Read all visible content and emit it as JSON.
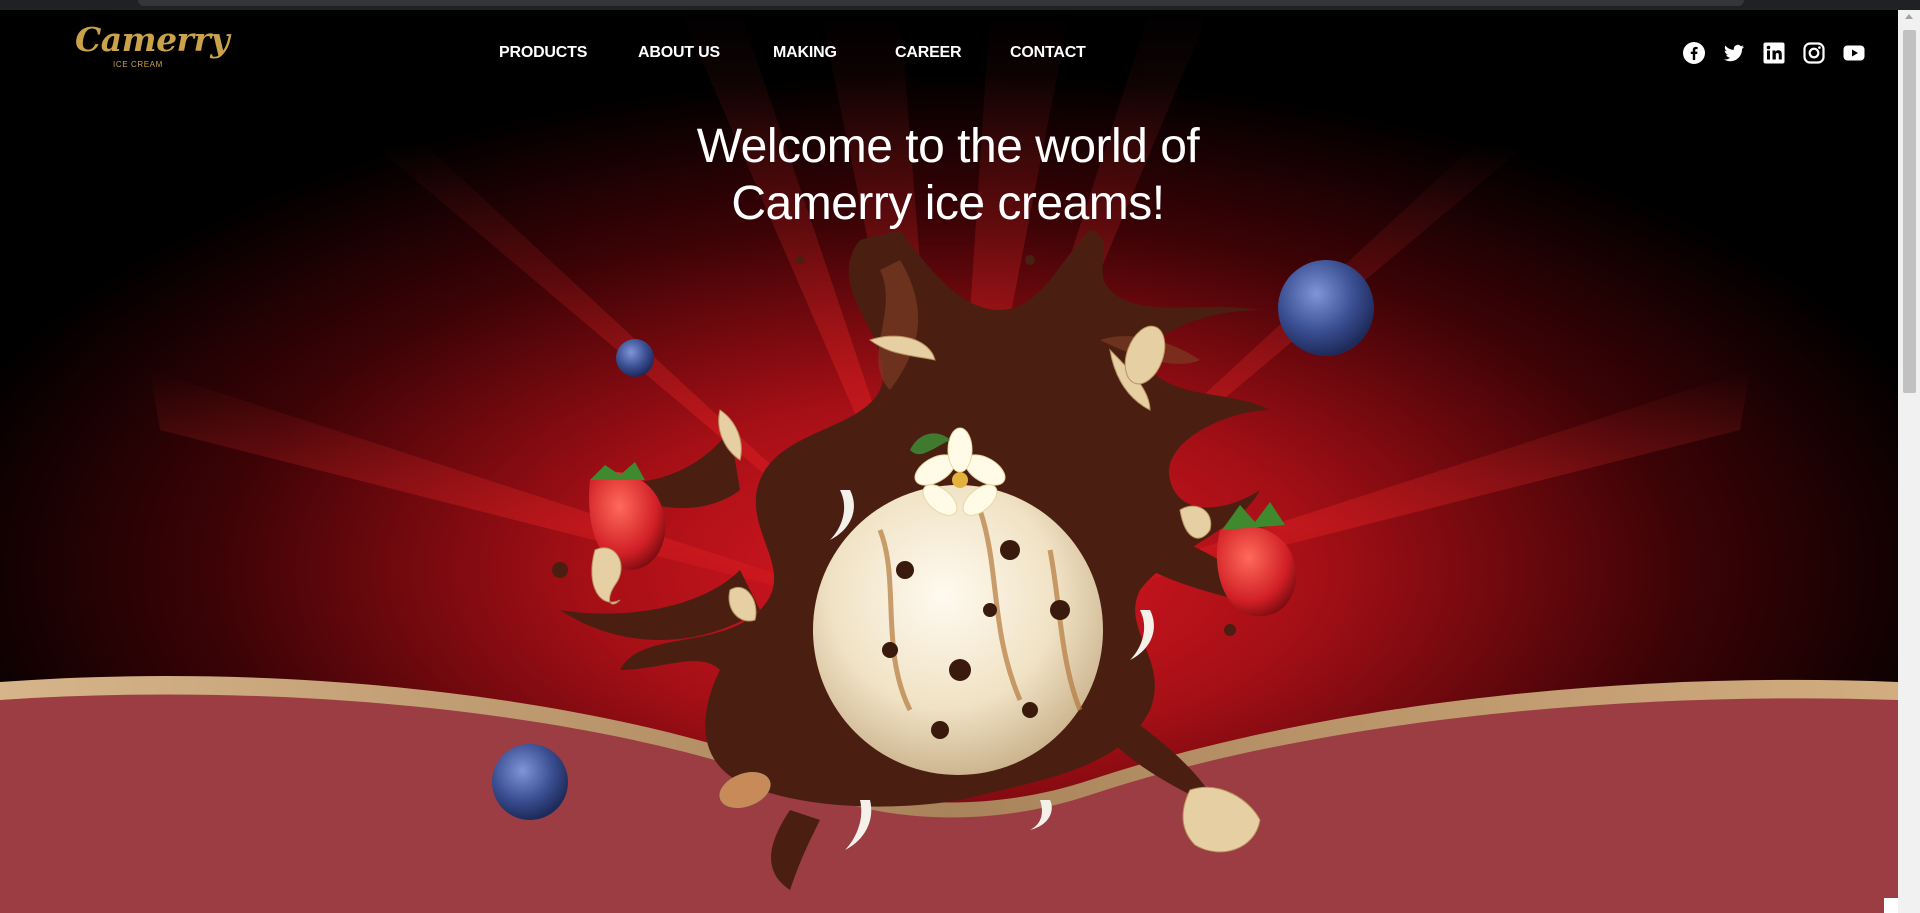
{
  "brand": {
    "name": "Camerry",
    "tagline": "ICE CREAM",
    "color": "#c9a24a"
  },
  "nav": {
    "items": [
      {
        "label": "PRODUCTS"
      },
      {
        "label": "ABOUT US"
      },
      {
        "label": "MAKING"
      },
      {
        "label": "CAREER"
      },
      {
        "label": "CONTACT"
      }
    ]
  },
  "social": [
    {
      "icon": "facebook-icon"
    },
    {
      "icon": "twitter-icon"
    },
    {
      "icon": "linkedin-icon"
    },
    {
      "icon": "instagram-icon"
    },
    {
      "icon": "youtube-icon"
    }
  ],
  "hero": {
    "headline_line1": "Welcome to the world of",
    "headline_line2": "Camerry ice creams!",
    "colors": {
      "background": "#000000",
      "rays": "#c0121a",
      "wave": "#9b3d42",
      "wave_trim": "#c8a06a",
      "chocolate": "#4a1f12",
      "ice_cream": "#f3e8cf"
    }
  }
}
